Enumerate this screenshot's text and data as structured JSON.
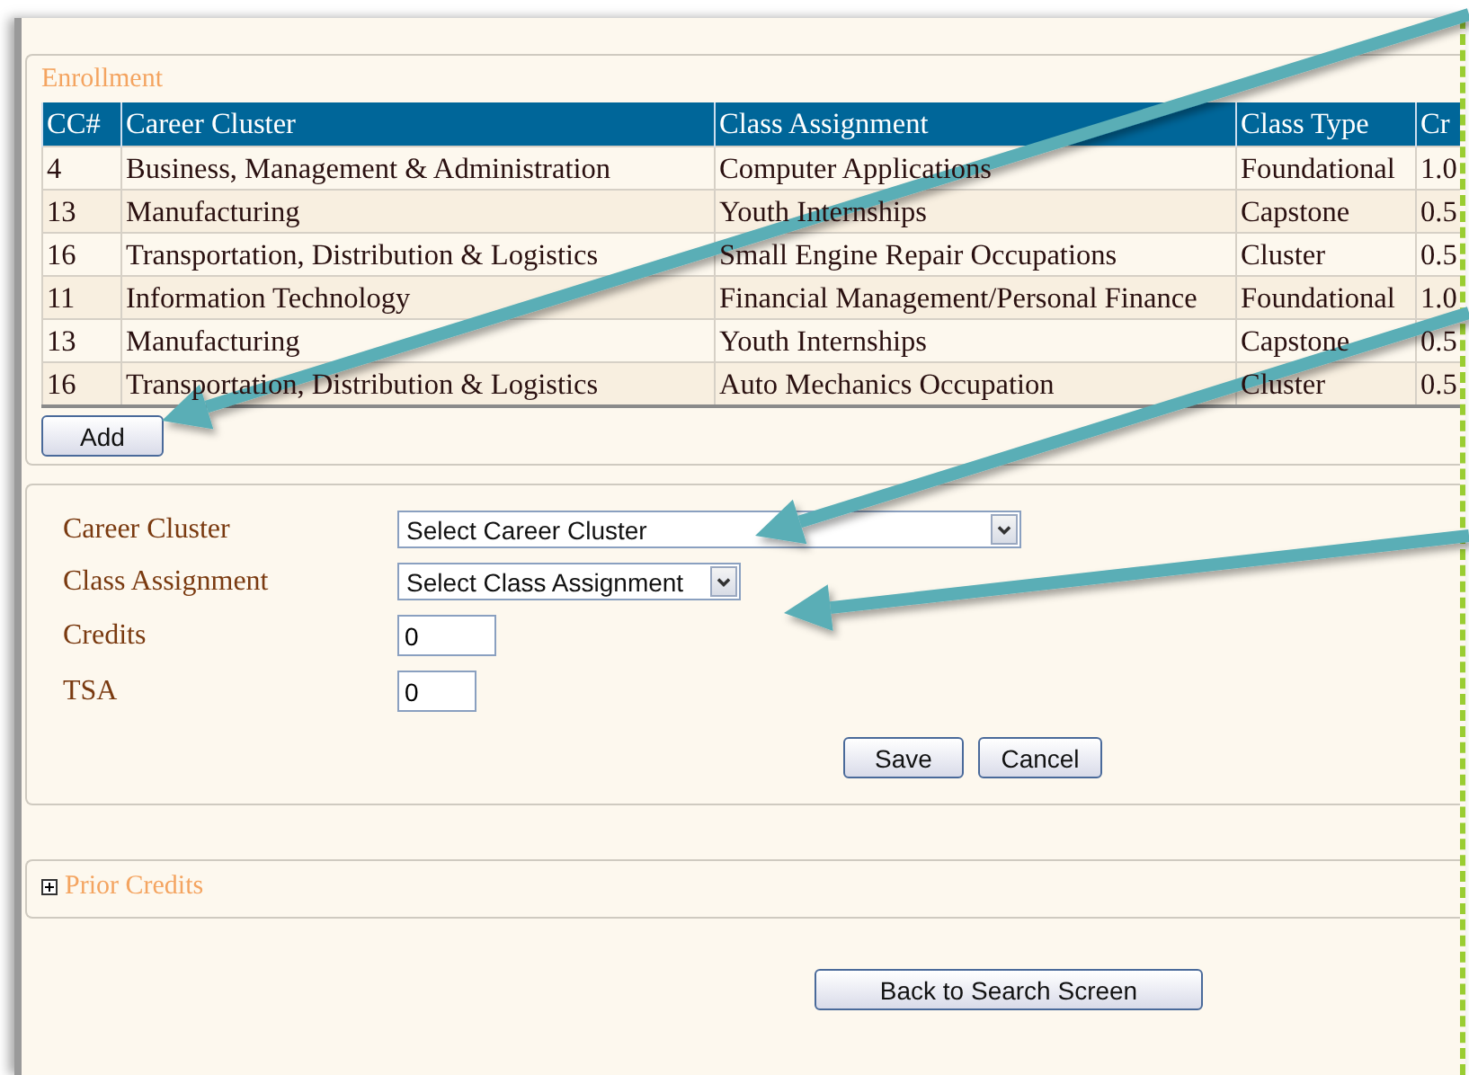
{
  "enrollment": {
    "title": "Enrollment",
    "columns": [
      "CC#",
      "Career Cluster",
      "Class Assignment",
      "Class Type",
      "Cr"
    ],
    "rows": [
      [
        "4",
        "Business, Management & Administration",
        "Computer Applications",
        "Foundational",
        "1.0"
      ],
      [
        "13",
        "Manufacturing",
        "Youth Internships",
        "Capstone",
        "0.5"
      ],
      [
        "16",
        "Transportation, Distribution & Logistics",
        "Small Engine Repair Occupations",
        "Cluster",
        "0.5"
      ],
      [
        "11",
        "Information Technology",
        "Financial Management/Personal Finance",
        "Foundational",
        "1.0"
      ],
      [
        "13",
        "Manufacturing",
        "Youth Internships",
        "Capstone",
        "0.5"
      ],
      [
        "16",
        "Transportation, Distribution & Logistics",
        "Auto Mechanics Occupation",
        "Cluster",
        "0.5"
      ]
    ]
  },
  "add_button": "Add",
  "form": {
    "fields": [
      {
        "kind": "select",
        "label": "Career Cluster",
        "value": "Select Career Cluster"
      },
      {
        "kind": "select",
        "label": "Class Assignment",
        "value": "Select Class Assignment"
      },
      {
        "kind": "text",
        "label": "Credits",
        "value": "0"
      },
      {
        "kind": "text",
        "label": "TSA",
        "value": "0"
      }
    ],
    "buttons": [
      "Save",
      "Cancel"
    ]
  },
  "prior_credits": {
    "title": "Prior Credits",
    "expanded": false
  },
  "back_button": "Back to Search Screen"
}
